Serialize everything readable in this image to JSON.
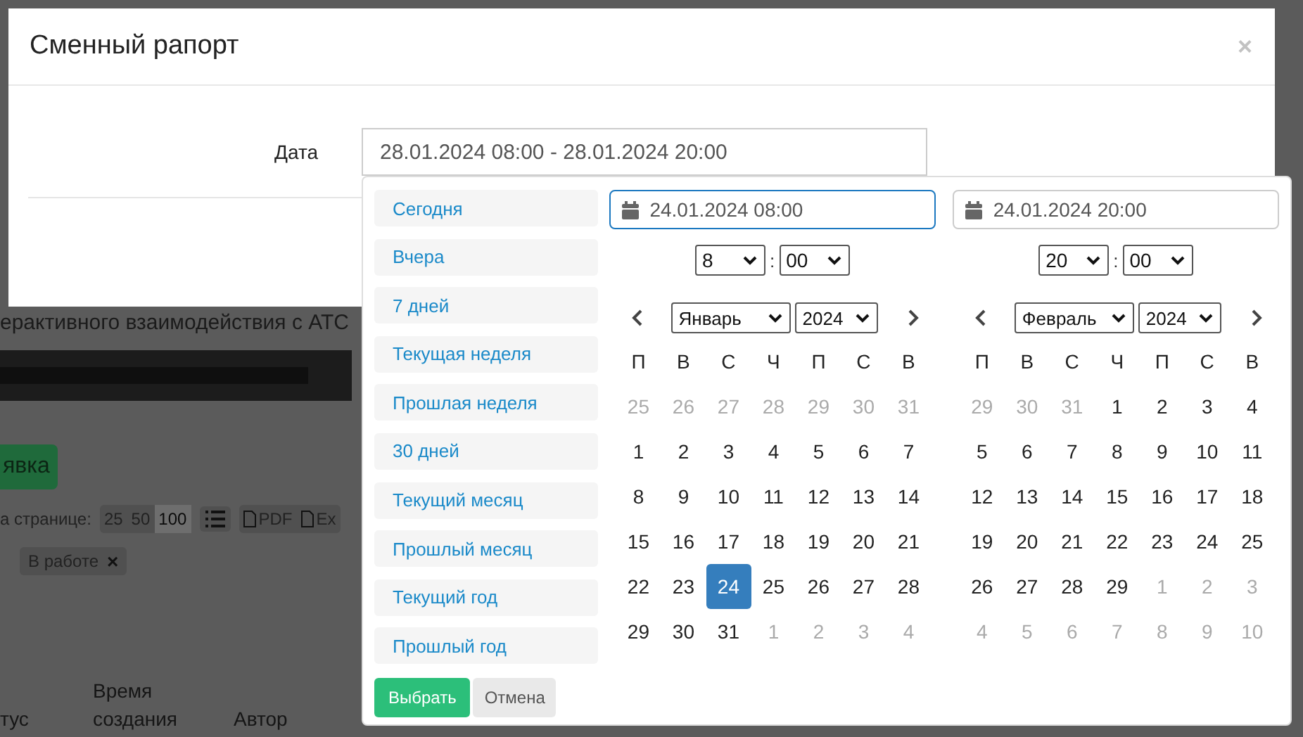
{
  "page": {
    "subtitle": "ерактивного взаимодействия с АТС",
    "new_button": "явка",
    "per_page_label": "а странице:",
    "per_page": [
      {
        "label": "25",
        "selected": false
      },
      {
        "label": "50",
        "selected": false
      },
      {
        "label": "100",
        "selected": true
      }
    ],
    "exports": [
      "PDF",
      "Ex"
    ],
    "filter_tag": {
      "label": "В работе",
      "remove": "×"
    },
    "columns": [
      "тус",
      "Время создания",
      "Автор"
    ]
  },
  "modal": {
    "title": "Сменный рапорт",
    "close": "×",
    "field_label": "Дата",
    "field_value": "28.01.2024 08:00 - 28.01.2024 20:00"
  },
  "picker": {
    "ranges": [
      "Сегодня",
      "Вчера",
      "7 дней",
      "Текущая неделя",
      "Прошлая неделя",
      "30 дней",
      "Текущий месяц",
      "Прошлый месяц",
      "Текущий год",
      "Прошлый год"
    ],
    "calendars": [
      {
        "input": "24.01.2024 08:00",
        "focused": true,
        "separator": ":",
        "hour": "8",
        "minute": "00",
        "month": "Январь",
        "year": "2024",
        "weekdays": [
          "П",
          "В",
          "С",
          "Ч",
          "П",
          "С",
          "В"
        ],
        "days": [
          {
            "label": "25",
            "muted": true,
            "selected": false
          },
          {
            "label": "26",
            "muted": true,
            "selected": false
          },
          {
            "label": "27",
            "muted": true,
            "selected": false
          },
          {
            "label": "28",
            "muted": true,
            "selected": false
          },
          {
            "label": "29",
            "muted": true,
            "selected": false
          },
          {
            "label": "30",
            "muted": true,
            "selected": false
          },
          {
            "label": "31",
            "muted": true,
            "selected": false
          },
          {
            "label": "1",
            "muted": false,
            "selected": false
          },
          {
            "label": "2",
            "muted": false,
            "selected": false
          },
          {
            "label": "3",
            "muted": false,
            "selected": false
          },
          {
            "label": "4",
            "muted": false,
            "selected": false
          },
          {
            "label": "5",
            "muted": false,
            "selected": false
          },
          {
            "label": "6",
            "muted": false,
            "selected": false
          },
          {
            "label": "7",
            "muted": false,
            "selected": false
          },
          {
            "label": "8",
            "muted": false,
            "selected": false
          },
          {
            "label": "9",
            "muted": false,
            "selected": false
          },
          {
            "label": "10",
            "muted": false,
            "selected": false
          },
          {
            "label": "11",
            "muted": false,
            "selected": false
          },
          {
            "label": "12",
            "muted": false,
            "selected": false
          },
          {
            "label": "13",
            "muted": false,
            "selected": false
          },
          {
            "label": "14",
            "muted": false,
            "selected": false
          },
          {
            "label": "15",
            "muted": false,
            "selected": false
          },
          {
            "label": "16",
            "muted": false,
            "selected": false
          },
          {
            "label": "17",
            "muted": false,
            "selected": false
          },
          {
            "label": "18",
            "muted": false,
            "selected": false
          },
          {
            "label": "19",
            "muted": false,
            "selected": false
          },
          {
            "label": "20",
            "muted": false,
            "selected": false
          },
          {
            "label": "21",
            "muted": false,
            "selected": false
          },
          {
            "label": "22",
            "muted": false,
            "selected": false
          },
          {
            "label": "23",
            "muted": false,
            "selected": false
          },
          {
            "label": "24",
            "muted": false,
            "selected": true
          },
          {
            "label": "25",
            "muted": false,
            "selected": false
          },
          {
            "label": "26",
            "muted": false,
            "selected": false
          },
          {
            "label": "27",
            "muted": false,
            "selected": false
          },
          {
            "label": "28",
            "muted": false,
            "selected": false
          },
          {
            "label": "29",
            "muted": false,
            "selected": false
          },
          {
            "label": "30",
            "muted": false,
            "selected": false
          },
          {
            "label": "31",
            "muted": false,
            "selected": false
          },
          {
            "label": "1",
            "muted": true,
            "selected": false
          },
          {
            "label": "2",
            "muted": true,
            "selected": false
          },
          {
            "label": "3",
            "muted": true,
            "selected": false
          },
          {
            "label": "4",
            "muted": true,
            "selected": false
          }
        ]
      },
      {
        "input": "24.01.2024 20:00",
        "focused": false,
        "separator": ":",
        "hour": "20",
        "minute": "00",
        "month": "Февраль",
        "year": "2024",
        "weekdays": [
          "П",
          "В",
          "С",
          "Ч",
          "П",
          "С",
          "В"
        ],
        "days": [
          {
            "label": "29",
            "muted": true,
            "selected": false
          },
          {
            "label": "30",
            "muted": true,
            "selected": false
          },
          {
            "label": "31",
            "muted": true,
            "selected": false
          },
          {
            "label": "1",
            "muted": false,
            "selected": false
          },
          {
            "label": "2",
            "muted": false,
            "selected": false
          },
          {
            "label": "3",
            "muted": false,
            "selected": false
          },
          {
            "label": "4",
            "muted": false,
            "selected": false
          },
          {
            "label": "5",
            "muted": false,
            "selected": false
          },
          {
            "label": "6",
            "muted": false,
            "selected": false
          },
          {
            "label": "7",
            "muted": false,
            "selected": false
          },
          {
            "label": "8",
            "muted": false,
            "selected": false
          },
          {
            "label": "9",
            "muted": false,
            "selected": false
          },
          {
            "label": "10",
            "muted": false,
            "selected": false
          },
          {
            "label": "11",
            "muted": false,
            "selected": false
          },
          {
            "label": "12",
            "muted": false,
            "selected": false
          },
          {
            "label": "13",
            "muted": false,
            "selected": false
          },
          {
            "label": "14",
            "muted": false,
            "selected": false
          },
          {
            "label": "15",
            "muted": false,
            "selected": false
          },
          {
            "label": "16",
            "muted": false,
            "selected": false
          },
          {
            "label": "17",
            "muted": false,
            "selected": false
          },
          {
            "label": "18",
            "muted": false,
            "selected": false
          },
          {
            "label": "19",
            "muted": false,
            "selected": false
          },
          {
            "label": "20",
            "muted": false,
            "selected": false
          },
          {
            "label": "21",
            "muted": false,
            "selected": false
          },
          {
            "label": "22",
            "muted": false,
            "selected": false
          },
          {
            "label": "23",
            "muted": false,
            "selected": false
          },
          {
            "label": "24",
            "muted": false,
            "selected": false
          },
          {
            "label": "25",
            "muted": false,
            "selected": false
          },
          {
            "label": "26",
            "muted": false,
            "selected": false
          },
          {
            "label": "27",
            "muted": false,
            "selected": false
          },
          {
            "label": "28",
            "muted": false,
            "selected": false
          },
          {
            "label": "29",
            "muted": false,
            "selected": false
          },
          {
            "label": "1",
            "muted": true,
            "selected": false
          },
          {
            "label": "2",
            "muted": true,
            "selected": false
          },
          {
            "label": "3",
            "muted": true,
            "selected": false
          },
          {
            "label": "4",
            "muted": true,
            "selected": false
          },
          {
            "label": "5",
            "muted": true,
            "selected": false
          },
          {
            "label": "6",
            "muted": true,
            "selected": false
          },
          {
            "label": "7",
            "muted": true,
            "selected": false
          },
          {
            "label": "8",
            "muted": true,
            "selected": false
          },
          {
            "label": "9",
            "muted": true,
            "selected": false
          },
          {
            "label": "10",
            "muted": true,
            "selected": false
          }
        ]
      }
    ],
    "apply": "Выбрать",
    "cancel": "Отмена"
  }
}
